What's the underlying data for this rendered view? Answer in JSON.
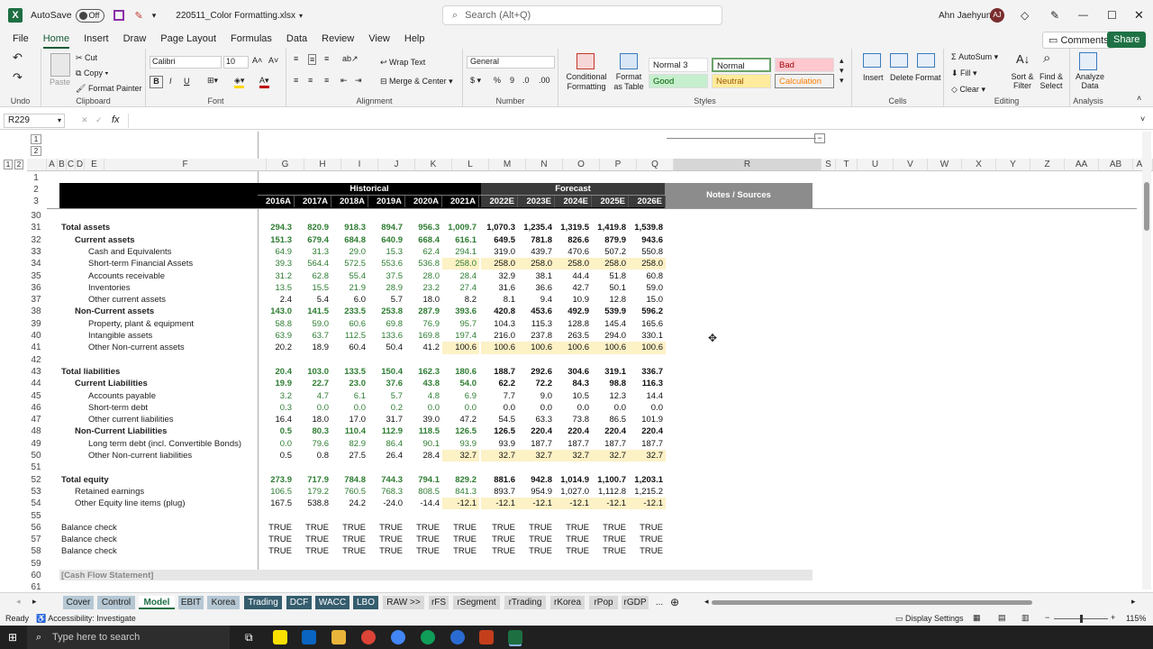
{
  "titlebar": {
    "autosave": "AutoSave",
    "toggle": "Off",
    "filename": "220511_Color Formatting.xlsx",
    "search_placeholder": "Search (Alt+Q)",
    "user": "Ahn Jaehyung",
    "initials": "AJ"
  },
  "menu": {
    "items": [
      "File",
      "Home",
      "Insert",
      "Draw",
      "Page Layout",
      "Formulas",
      "Data",
      "Review",
      "View",
      "Help"
    ],
    "comments": "Comments",
    "share": "Share"
  },
  "ribbon": {
    "undo": "Undo",
    "cut": "Cut",
    "copy": "Copy",
    "paste": "Paste",
    "format_painter": "Format Painter",
    "clipboard": "Clipboard",
    "font_name": "Calibri",
    "font_size": "10",
    "font": "Font",
    "bold": "B",
    "italic": "I",
    "underline": "U",
    "wrap_text": "Wrap Text",
    "merge_center": "Merge & Center",
    "alignment": "Alignment",
    "number_format": "General",
    "number": "Number",
    "conditional_formatting": "Conditional Formatting",
    "format_as_table": "Format as Table",
    "styles": {
      "normal3": "Normal 3",
      "normal": "Normal",
      "bad": "Bad",
      "good": "Good",
      "neutral": "Neutral",
      "calculation": "Calculation",
      "label": "Styles"
    },
    "insert": "Insert",
    "delete": "Delete",
    "format": "Format",
    "cells": "Cells",
    "autosum": "AutoSum",
    "fill": "Fill",
    "clear": "Clear",
    "sort_filter": "Sort & Filter",
    "find_select": "Find & Select",
    "editing": "Editing",
    "analyze_data": "Analyze Data",
    "analysis": "Analysis"
  },
  "formula": {
    "namebox": "R229",
    "fx": "fx",
    "content": ""
  },
  "grid": {
    "columns": [
      "A",
      "B",
      "C",
      "D",
      "E",
      "F",
      "G",
      "H",
      "I",
      "J",
      "K",
      "L",
      "M",
      "N",
      "O",
      "P",
      "Q",
      "R",
      "S",
      "T",
      "U",
      "V",
      "W",
      "X",
      "Y",
      "Z",
      "AA",
      "AB",
      "AC"
    ],
    "historical": "Historical",
    "forecast": "Forecast",
    "notes": "Notes / Sources",
    "years": [
      "2016A",
      "2017A",
      "2018A",
      "2019A",
      "2020A",
      "2021A",
      "2022E",
      "2023E",
      "2024E",
      "2025E",
      "2026E"
    ],
    "rows": [
      {
        "n": "30",
        "label": "",
        "indent": 0,
        "bold": false,
        "v": []
      },
      {
        "n": "31",
        "label": "Total assets",
        "indent": 0,
        "bold": true,
        "v": [
          "294.3",
          "820.9",
          "918.3",
          "894.7",
          "956.3",
          "1,009.7",
          "1,070.3",
          "1,235.4",
          "1,319.5",
          "1,419.8",
          "1,539.8"
        ]
      },
      {
        "n": "32",
        "label": "Current assets",
        "indent": 1,
        "bold": true,
        "v": [
          "151.3",
          "679.4",
          "684.8",
          "640.9",
          "668.4",
          "616.1",
          "649.5",
          "781.8",
          "826.6",
          "879.9",
          "943.6"
        ]
      },
      {
        "n": "33",
        "label": "Cash and Equivalents",
        "indent": 2,
        "bold": false,
        "v": [
          "64.9",
          "31.3",
          "29.0",
          "15.3",
          "62.4",
          "294.1",
          "319.0",
          "439.7",
          "470.6",
          "507.2",
          "550.8"
        ]
      },
      {
        "n": "34",
        "label": "Short-term Financial Assets",
        "indent": 2,
        "bold": false,
        "hl": true,
        "v": [
          "39.3",
          "564.4",
          "572.5",
          "553.6",
          "536.8",
          "258.0",
          "258.0",
          "258.0",
          "258.0",
          "258.0",
          "258.0"
        ]
      },
      {
        "n": "35",
        "label": "Accounts receivable",
        "indent": 2,
        "bold": false,
        "v": [
          "31.2",
          "62.8",
          "55.4",
          "37.5",
          "28.0",
          "28.4",
          "32.9",
          "38.1",
          "44.4",
          "51.8",
          "60.8"
        ]
      },
      {
        "n": "36",
        "label": "Inventories",
        "indent": 2,
        "bold": false,
        "v": [
          "13.5",
          "15.5",
          "21.9",
          "28.9",
          "23.2",
          "27.4",
          "31.6",
          "36.6",
          "42.7",
          "50.1",
          "59.0"
        ]
      },
      {
        "n": "37",
        "label": "Other current assets",
        "indent": 2,
        "bold": false,
        "black": true,
        "v": [
          "2.4",
          "5.4",
          "6.0",
          "5.7",
          "18.0",
          "8.2",
          "8.1",
          "9.4",
          "10.9",
          "12.8",
          "15.0"
        ]
      },
      {
        "n": "38",
        "label": "Non-Current assets",
        "indent": 1,
        "bold": true,
        "v": [
          "143.0",
          "141.5",
          "233.5",
          "253.8",
          "287.9",
          "393.6",
          "420.8",
          "453.6",
          "492.9",
          "539.9",
          "596.2"
        ]
      },
      {
        "n": "39",
        "label": "Property, plant & equipment",
        "indent": 2,
        "bold": false,
        "v": [
          "58.8",
          "59.0",
          "60.6",
          "69.8",
          "76.9",
          "95.7",
          "104.3",
          "115.3",
          "128.8",
          "145.4",
          "165.6"
        ]
      },
      {
        "n": "40",
        "label": "Intangible assets",
        "indent": 2,
        "bold": false,
        "v": [
          "63.9",
          "63.7",
          "112.5",
          "133.6",
          "169.8",
          "197.4",
          "216.0",
          "237.8",
          "263.5",
          "294.0",
          "330.1"
        ]
      },
      {
        "n": "41",
        "label": "Other Non-current assets",
        "indent": 2,
        "bold": false,
        "hl": true,
        "black": true,
        "v": [
          "20.2",
          "18.9",
          "60.4",
          "50.4",
          "41.2",
          "100.6",
          "100.6",
          "100.6",
          "100.6",
          "100.6",
          "100.6"
        ]
      },
      {
        "n": "42",
        "label": "",
        "indent": 0,
        "bold": false,
        "v": []
      },
      {
        "n": "43",
        "label": "Total liabilities",
        "indent": 0,
        "bold": true,
        "v": [
          "20.4",
          "103.0",
          "133.5",
          "150.4",
          "162.3",
          "180.6",
          "188.7",
          "292.6",
          "304.6",
          "319.1",
          "336.7"
        ]
      },
      {
        "n": "44",
        "label": "Current Liabilities",
        "indent": 1,
        "bold": true,
        "v": [
          "19.9",
          "22.7",
          "23.0",
          "37.6",
          "43.8",
          "54.0",
          "62.2",
          "72.2",
          "84.3",
          "98.8",
          "116.3"
        ]
      },
      {
        "n": "45",
        "label": "Accounts payable",
        "indent": 2,
        "bold": false,
        "v": [
          "3.2",
          "4.7",
          "6.1",
          "5.7",
          "4.8",
          "6.9",
          "7.7",
          "9.0",
          "10.5",
          "12.3",
          "14.4"
        ]
      },
      {
        "n": "46",
        "label": "Short-term debt",
        "indent": 2,
        "bold": false,
        "v": [
          "0.3",
          "0.0",
          "0.0",
          "0.2",
          "0.0",
          "0.0",
          "0.0",
          "0.0",
          "0.0",
          "0.0",
          "0.0"
        ]
      },
      {
        "n": "47",
        "label": "Other current liabilities",
        "indent": 2,
        "bold": false,
        "black": true,
        "v": [
          "16.4",
          "18.0",
          "17.0",
          "31.7",
          "39.0",
          "47.2",
          "54.5",
          "63.3",
          "73.8",
          "86.5",
          "101.9"
        ]
      },
      {
        "n": "48",
        "label": "Non-Current Liabilities",
        "indent": 1,
        "bold": true,
        "v": [
          "0.5",
          "80.3",
          "110.4",
          "112.9",
          "118.5",
          "126.5",
          "126.5",
          "220.4",
          "220.4",
          "220.4",
          "220.4"
        ]
      },
      {
        "n": "49",
        "label": "Long term debt (incl. Convertible Bonds)",
        "indent": 2,
        "bold": false,
        "v": [
          "0.0",
          "79.6",
          "82.9",
          "86.4",
          "90.1",
          "93.9",
          "93.9",
          "187.7",
          "187.7",
          "187.7",
          "187.7"
        ]
      },
      {
        "n": "50",
        "label": "Other Non-current liabilities",
        "indent": 2,
        "bold": false,
        "hl": true,
        "black": true,
        "v": [
          "0.5",
          "0.8",
          "27.5",
          "26.4",
          "28.4",
          "32.7",
          "32.7",
          "32.7",
          "32.7",
          "32.7",
          "32.7"
        ]
      },
      {
        "n": "51",
        "label": "",
        "indent": 0,
        "bold": false,
        "v": []
      },
      {
        "n": "52",
        "label": "Total equity",
        "indent": 0,
        "bold": true,
        "v": [
          "273.9",
          "717.9",
          "784.8",
          "744.3",
          "794.1",
          "829.2",
          "881.6",
          "942.8",
          "1,014.9",
          "1,100.7",
          "1,203.1"
        ]
      },
      {
        "n": "53",
        "label": "Retained earnings",
        "indent": 1,
        "bold": false,
        "v": [
          "106.5",
          "179.2",
          "760.5",
          "768.3",
          "808.5",
          "841.3",
          "893.7",
          "954.9",
          "1,027.0",
          "1,112.8",
          "1,215.2"
        ]
      },
      {
        "n": "54",
        "label": "Other Equity line items (plug)",
        "indent": 1,
        "bold": false,
        "hl": true,
        "black": true,
        "v": [
          "167.5",
          "538.8",
          "24.2",
          "-24.0",
          "-14.4",
          "-12.1",
          "-12.1",
          "-12.1",
          "-12.1",
          "-12.1",
          "-12.1"
        ]
      },
      {
        "n": "55",
        "label": "",
        "indent": 0,
        "bold": false,
        "v": []
      },
      {
        "n": "56",
        "label": "Balance check",
        "indent": 0,
        "bold": false,
        "black": true,
        "v": [
          "TRUE",
          "TRUE",
          "TRUE",
          "TRUE",
          "TRUE",
          "TRUE",
          "TRUE",
          "TRUE",
          "TRUE",
          "TRUE",
          "TRUE"
        ]
      },
      {
        "n": "57",
        "label": "Balance check",
        "indent": 0,
        "bold": false,
        "black": true,
        "v": [
          "TRUE",
          "TRUE",
          "TRUE",
          "TRUE",
          "TRUE",
          "TRUE",
          "TRUE",
          "TRUE",
          "TRUE",
          "TRUE",
          "TRUE"
        ]
      },
      {
        "n": "58",
        "label": "Balance check",
        "indent": 0,
        "bold": false,
        "black": true,
        "v": [
          "TRUE",
          "TRUE",
          "TRUE",
          "TRUE",
          "TRUE",
          "TRUE",
          "TRUE",
          "TRUE",
          "TRUE",
          "TRUE",
          "TRUE"
        ]
      },
      {
        "n": "59",
        "label": "",
        "indent": 0,
        "bold": false,
        "v": []
      },
      {
        "n": "60",
        "label": "[Cash Flow Statement]",
        "indent": 0,
        "bold": true,
        "section": true,
        "v": []
      },
      {
        "n": "61",
        "label": "",
        "indent": 0,
        "bold": false,
        "v": []
      }
    ]
  },
  "tabs": [
    "Cover",
    "Control",
    "Model",
    "EBIT",
    "Korea",
    "Trading",
    "DCF",
    "WACC",
    "LBO",
    "RAW >>",
    "rFS",
    "rSegment",
    "rTrading",
    "rKorea",
    "rPop",
    "rGDP",
    "..."
  ],
  "active_tab": "Model",
  "status": {
    "ready": "Ready",
    "accessibility": "Accessibility: Investigate",
    "display": "Display Settings",
    "zoom": "115%"
  },
  "taskbar": {
    "search": "Type here to search"
  },
  "colors": {
    "excel_green": "#1d6f42",
    "hist_green": "#2e7d32",
    "forecast_header": "#3a3a3a",
    "highlight": "#fdf1c6"
  }
}
